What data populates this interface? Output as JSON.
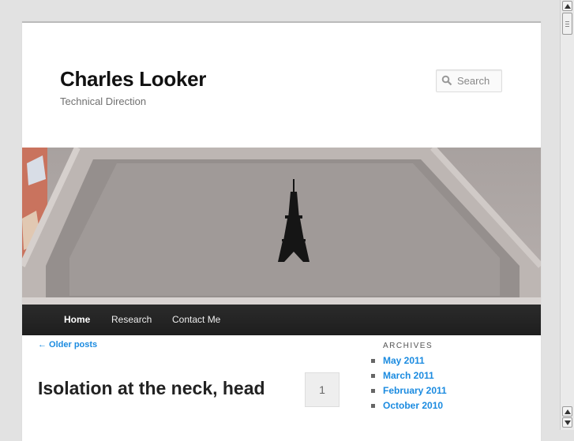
{
  "site": {
    "title": "Charles Looker",
    "description": "Technical Direction"
  },
  "search": {
    "placeholder": "Search",
    "icon": "search-icon"
  },
  "nav": {
    "items": [
      {
        "label": "Home",
        "active": true
      },
      {
        "label": "Research",
        "active": false
      },
      {
        "label": "Contact Me",
        "active": false
      }
    ]
  },
  "content": {
    "older_posts": "← Older posts",
    "post_title": "Isolation at the neck, head",
    "comment_count": "1"
  },
  "sidebar": {
    "archives_title": "Archives",
    "archives": [
      "May 2011",
      "March 2011",
      "February 2011",
      "October 2010"
    ]
  },
  "colors": {
    "link": "#1b8be0",
    "nav_bg": "#222222",
    "page_bg": "#e2e2e2"
  }
}
